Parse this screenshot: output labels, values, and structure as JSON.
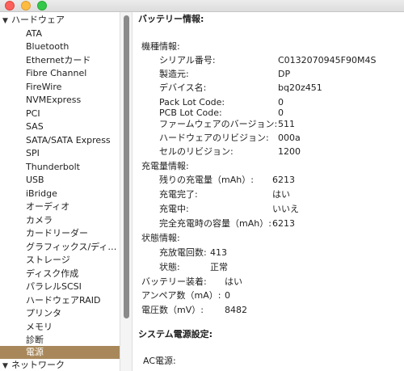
{
  "sidebar": {
    "hardware_header": "ハードウェア",
    "items": [
      "ATA",
      "Bluetooth",
      "Ethernetカード",
      "Fibre Channel",
      "FireWire",
      "NVMExpress",
      "PCI",
      "SAS",
      "SATA/SATA Express",
      "SPI",
      "Thunderbolt",
      "USB",
      "iBridge",
      "オーディオ",
      "カメラ",
      "カードリーダー",
      "グラフィックス/ディ…",
      "ストレージ",
      "ディスク作成",
      "パラレルSCSI",
      "ハードウェアRAID",
      "プリンタ",
      "メモリ",
      "診断",
      "電源"
    ],
    "network_header": "ネットワーク"
  },
  "content": {
    "battery_title": "バッテリー情報:",
    "machine_info": {
      "heading": "機種情報:",
      "serial": {
        "label": "シリアル番号:",
        "value": "C0132070945F90M4S"
      },
      "manufacturer": {
        "label": "製造元:",
        "value": "DP"
      },
      "device_name": {
        "label": "デバイス名:",
        "value": "bq20z451"
      },
      "pack_lot": {
        "label": "Pack Lot Code:",
        "value": "0"
      },
      "pcb_lot": {
        "label": "PCB Lot Code:",
        "value": "0"
      },
      "firmware": {
        "label": "ファームウェアのバージョン:",
        "value": "511"
      },
      "hardware_rev": {
        "label": "ハードウェアのリビジョン:",
        "value": "000a"
      },
      "cell_rev": {
        "label": "セルのリビジョン:",
        "value": "1200"
      }
    },
    "charge_info": {
      "heading": "充電量情報:",
      "remaining": {
        "label": "残りの充電量（mAh）:",
        "value": "6213"
      },
      "fully_charged": {
        "label": "充電完了:",
        "value": "はい"
      },
      "charging": {
        "label": "充電中:",
        "value": "いいえ"
      },
      "full_capacity": {
        "label": "完全充電時の容量（mAh）:",
        "value": "6213"
      }
    },
    "status_info": {
      "heading": "状態情報:",
      "cycle_count": {
        "label": "充放電回数:",
        "value": "413"
      },
      "condition": {
        "label": "状態:",
        "value": "正常"
      }
    },
    "battery_installed": {
      "label": "バッテリー装着:",
      "value": "はい"
    },
    "amperage": {
      "label": "アンペア数（mA）:",
      "value": "0"
    },
    "voltage": {
      "label": "電圧数（mV）:",
      "value": "8482"
    },
    "system_power_title": "システム電源設定:",
    "ac_power": "AC電源:"
  }
}
